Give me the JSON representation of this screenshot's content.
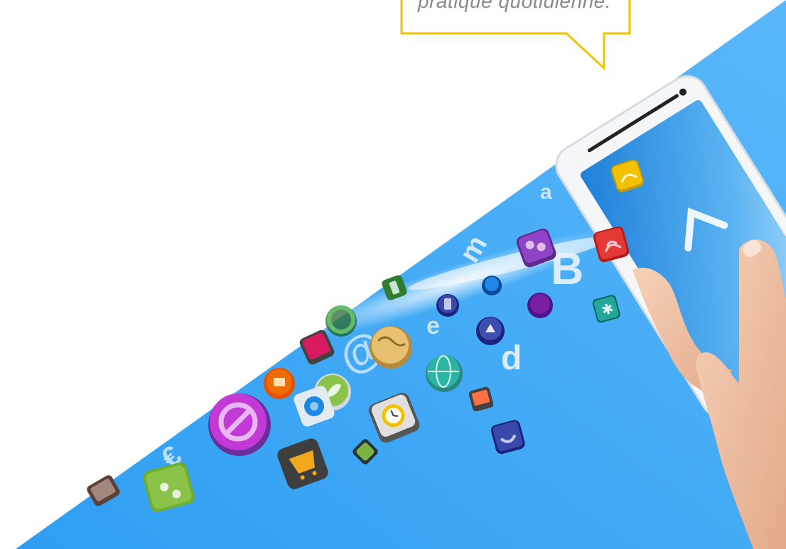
{
  "quote": {
    "text": "pratique quotidienne."
  },
  "colors": {
    "background": "#ffffff",
    "accent_yellow": "#f2c200",
    "sky_blue": "#3fa9f5",
    "sky_blue_light": "#7cc6fb",
    "tablet_frame": "#f4f6f8",
    "screen_blue": "#2f8fe0",
    "skin": "#f1c5a8"
  },
  "illustration": {
    "icons": [
      {
        "name": "no-entry-icon",
        "color": "#c23ad6"
      },
      {
        "name": "shopping-cart-icon",
        "color": "#555555"
      },
      {
        "name": "globe-icon",
        "color": "#2bb5a4"
      },
      {
        "name": "clock-icon",
        "color": "#d8d8d8"
      },
      {
        "name": "wifi-icon",
        "color": "#e53935"
      },
      {
        "name": "chat-bubbles-icon",
        "color": "#8e44c4"
      },
      {
        "name": "network-icon",
        "color": "#8bc34a"
      },
      {
        "name": "upload-icon",
        "color": "#3d4db0"
      },
      {
        "name": "rss-icon",
        "color": "#f2c200"
      },
      {
        "name": "star-icon",
        "color": "#26a69a"
      },
      {
        "name": "world-map-icon",
        "color": "#e8c170"
      },
      {
        "name": "leaf-icon",
        "color": "#43a047"
      },
      {
        "name": "phone-icon",
        "color": "#3949ab"
      },
      {
        "name": "tv-icon",
        "color": "#444444"
      },
      {
        "name": "bag-icon",
        "color": "#ef6c00"
      },
      {
        "name": "gift-icon",
        "color": "#d81b60"
      }
    ]
  }
}
